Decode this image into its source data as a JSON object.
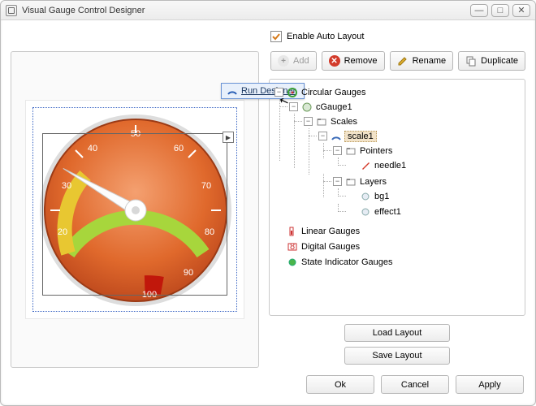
{
  "window": {
    "title": "Visual Gauge Control Designer",
    "min": "—",
    "max": "□",
    "close": "✕"
  },
  "checkbox": {
    "label": "Enable Auto Layout",
    "checked": true
  },
  "toolbar": {
    "add": "Add",
    "remove": "Remove",
    "rename": "Rename",
    "duplicate": "Duplicate"
  },
  "popup": {
    "label": "Run Designer"
  },
  "gauge_ticks": [
    "20",
    "30",
    "40",
    "50",
    "60",
    "70",
    "80",
    "90",
    "100"
  ],
  "tree": {
    "root0": "Circular Gauges",
    "cgauge": "cGauge1",
    "scales": "Scales",
    "scale1": "scale1",
    "pointers": "Pointers",
    "needle1": "needle1",
    "layers": "Layers",
    "bg1": "bg1",
    "effect1": "effect1",
    "root1": "Linear Gauges",
    "root2": "Digital Gauges",
    "root3": "State Indicator Gauges"
  },
  "layout": {
    "load": "Load Layout",
    "save": "Save Layout"
  },
  "footer": {
    "ok": "Ok",
    "cancel": "Cancel",
    "apply": "Apply"
  }
}
